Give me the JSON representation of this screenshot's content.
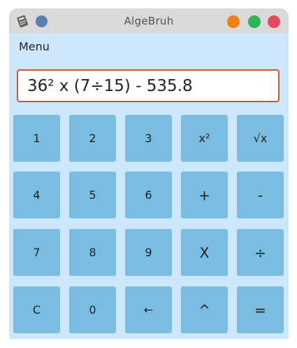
{
  "window": {
    "title": "AlgeBruh",
    "colors": {
      "titlebar": "#d9d9d9",
      "background": "#cce7fb",
      "key": "#7bbde1",
      "display_border": "#c65a2a",
      "minimize": "#f17f16",
      "maximize": "#2eb358",
      "close": "#e4495e"
    }
  },
  "menu": {
    "label": "Menu"
  },
  "display": {
    "expression": "36² x (7÷15) - 535.8"
  },
  "keys": [
    [
      "1",
      "2",
      "3",
      "x²",
      "√x"
    ],
    [
      "4",
      "5",
      "6",
      "+",
      "-"
    ],
    [
      "7",
      "8",
      "9",
      "X",
      "÷"
    ],
    [
      "C",
      "0",
      "←",
      "^",
      "="
    ]
  ]
}
